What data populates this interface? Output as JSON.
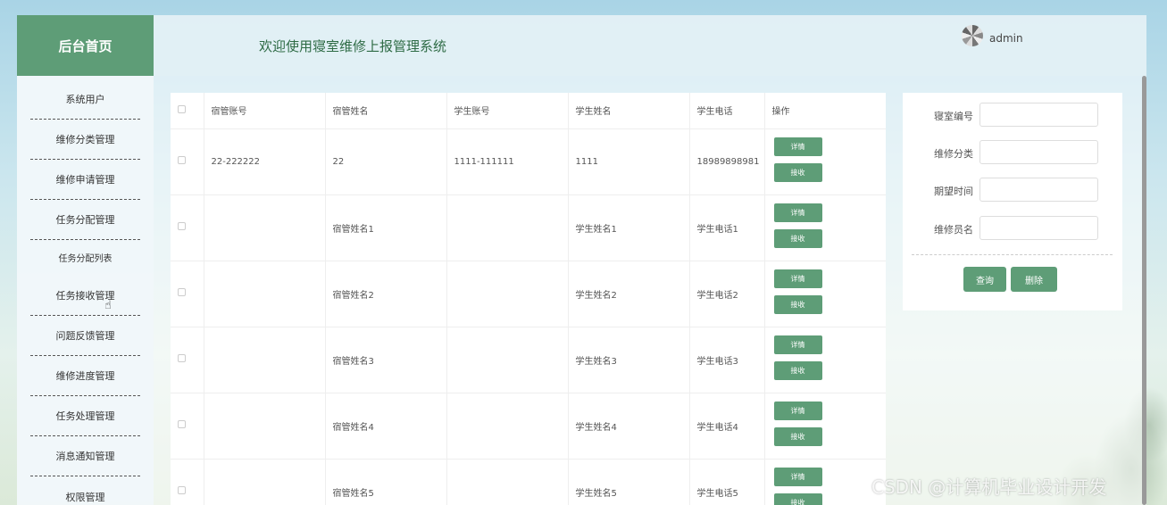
{
  "app": {
    "logo_text": "后台首页",
    "welcome": "欢迎使用寝室维修上报管理系统",
    "username": "admin"
  },
  "sidebar": {
    "items": [
      {
        "label": "系统用户"
      },
      {
        "label": "维修分类管理"
      },
      {
        "label": "维修申请管理"
      },
      {
        "label": "任务分配管理"
      },
      {
        "label": "任务分配列表"
      },
      {
        "label": "任务接收管理"
      },
      {
        "label": "问题反馈管理"
      },
      {
        "label": "维修进度管理"
      },
      {
        "label": "任务处理管理"
      },
      {
        "label": "消息通知管理"
      },
      {
        "label": "权限管理"
      }
    ]
  },
  "table": {
    "headers": [
      "宿管账号",
      "宿管姓名",
      "学生账号",
      "学生姓名",
      "学生电话",
      "操作"
    ],
    "detail_label": "详情",
    "receive_label": "接收",
    "rows": [
      {
        "dorm_account": "22-222222",
        "dorm_name": "22",
        "student_account": "1111-111111",
        "student_name": "1111",
        "student_phone": "18989898981"
      },
      {
        "dorm_account": "",
        "dorm_name": "宿管姓名1",
        "student_account": "",
        "student_name": "学生姓名1",
        "student_phone": "学生电话1"
      },
      {
        "dorm_account": "",
        "dorm_name": "宿管姓名2",
        "student_account": "",
        "student_name": "学生姓名2",
        "student_phone": "学生电话2"
      },
      {
        "dorm_account": "",
        "dorm_name": "宿管姓名3",
        "student_account": "",
        "student_name": "学生姓名3",
        "student_phone": "学生电话3"
      },
      {
        "dorm_account": "",
        "dorm_name": "宿管姓名4",
        "student_account": "",
        "student_name": "学生姓名4",
        "student_phone": "学生电话4"
      },
      {
        "dorm_account": "",
        "dorm_name": "宿管姓名5",
        "student_account": "",
        "student_name": "学生姓名5",
        "student_phone": "学生电话5"
      }
    ]
  },
  "search": {
    "fields": [
      {
        "label": "寝室编号",
        "value": ""
      },
      {
        "label": "维修分类",
        "value": ""
      },
      {
        "label": "期望时间",
        "value": ""
      },
      {
        "label": "维修员名",
        "value": ""
      }
    ],
    "query_label": "查询",
    "delete_label": "删除"
  },
  "watermark": "CSDN @计算机毕业设计开发",
  "colors": {
    "accent": "#5e9d77"
  }
}
